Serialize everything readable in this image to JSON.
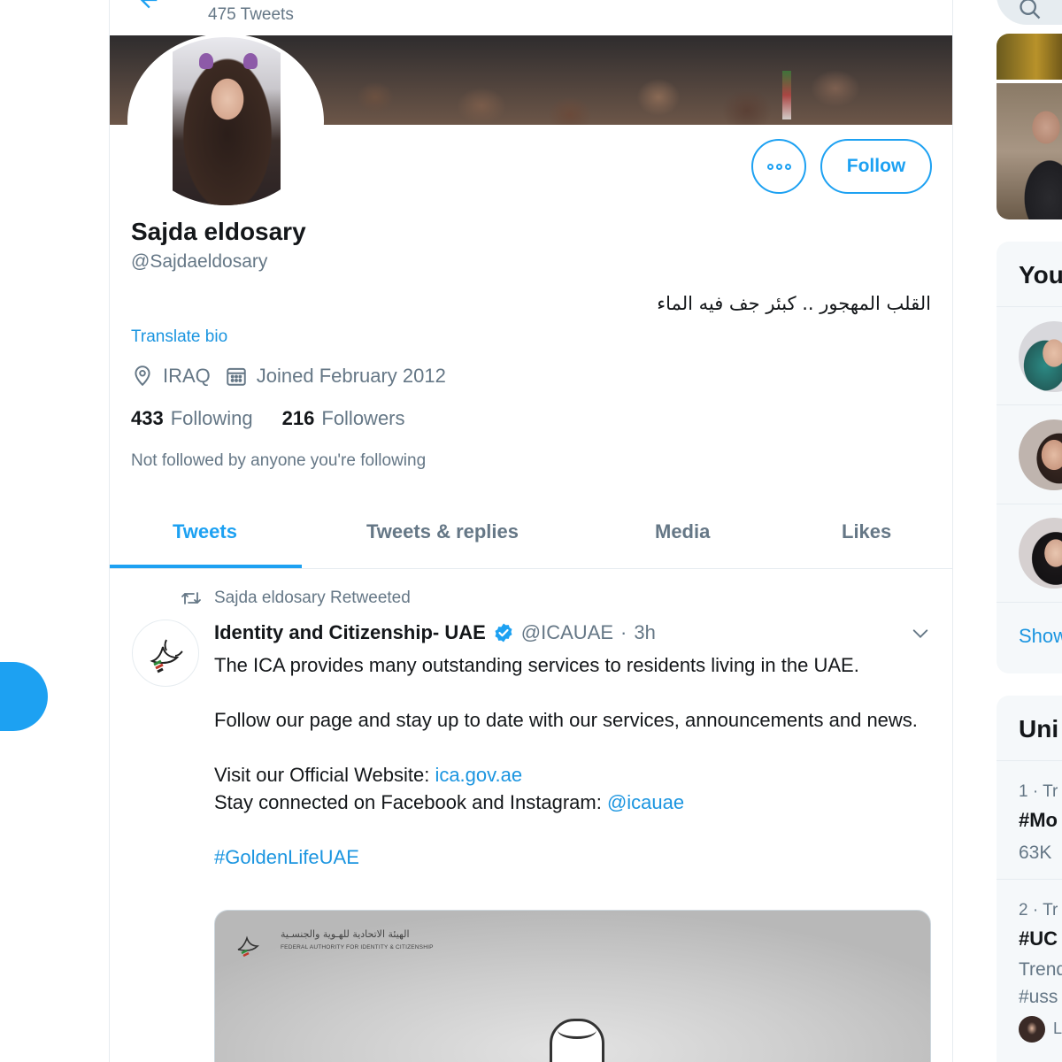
{
  "header": {
    "tweet_count": "475 Tweets"
  },
  "profile": {
    "name": "Sajda eldosary",
    "handle": "@Sajdaeldosary",
    "bio": "القلب المهجور .. كبئر جف فيه الماء",
    "translate_label": "Translate bio",
    "location": "IRAQ",
    "joined": "Joined February 2012",
    "following_count": "433",
    "following_label": "Following",
    "followers_count": "216",
    "followers_label": "Followers",
    "not_followed": "Not followed by anyone you're following",
    "follow_button": "Follow"
  },
  "tabs": [
    {
      "label": "Tweets",
      "active": true
    },
    {
      "label": "Tweets & replies",
      "active": false
    },
    {
      "label": "Media",
      "active": false
    },
    {
      "label": "Likes",
      "active": false
    }
  ],
  "tweet": {
    "retweeted_by": "Sajda eldosary Retweeted",
    "author_name": "Identity and Citizenship- UAE",
    "author_handle": "@ICAUAE",
    "dot": "·",
    "time": "3h",
    "line1": "The ICA provides many outstanding services to residents living in the UAE.",
    "line2": "Follow our page and stay up to date with our services, announcements and news.",
    "line3_prefix": "Visit our Official Website: ",
    "line3_link": "ica.gov.ae",
    "line4_prefix": "Stay connected on Facebook and Instagram: ",
    "line4_link": "@icauae",
    "hashtag": "#GoldenLifeUAE",
    "media_arabic": "الهيئة الاتحادية للهـوية والجنسـية",
    "media_english": "FEDERAL AUTHORITY FOR IDENTITY & CITIZENSHIP"
  },
  "sidebar": {
    "card1_title": "You",
    "card1_show": "Show",
    "card2_title": "Uni",
    "trends": [
      {
        "num": "1 · Tr",
        "tag": "#Mo",
        "sub": "63K"
      },
      {
        "num": "2 · Tr",
        "tag": "#UC",
        "sub1": "Trend",
        "sub2": "#uss",
        "mini": "La"
      }
    ]
  },
  "colors": {
    "accent": "#1da1f2",
    "link": "#1b95e0",
    "secondary_text": "#657786",
    "border": "#e6ecf0"
  }
}
